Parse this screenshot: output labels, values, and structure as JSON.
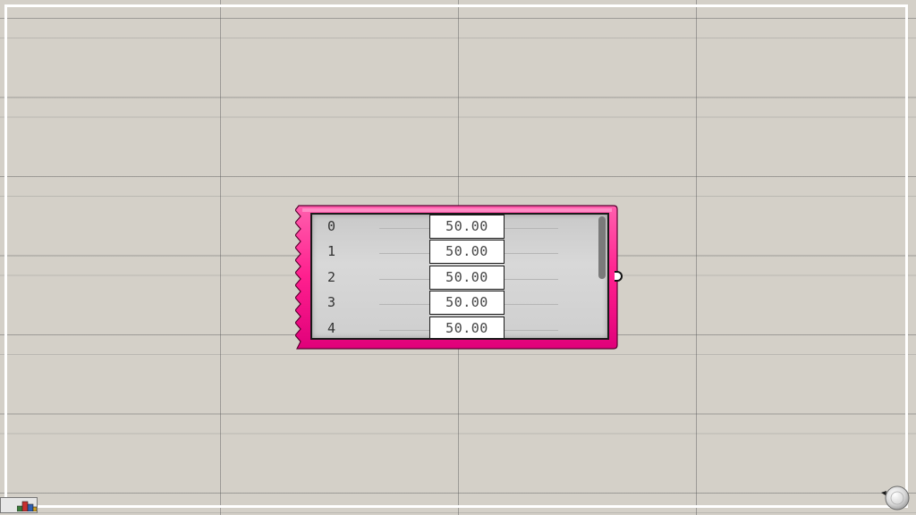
{
  "canvas": {
    "background_color": "#d4d0c8",
    "grid_color": "#5a5a5a",
    "frame_color": "#ffffff"
  },
  "component": {
    "type": "number-list-panel",
    "accent_color": "#ff1f8e",
    "accent_dark": "#c8005f",
    "rows": [
      {
        "index": "0",
        "value": "50.00"
      },
      {
        "index": "1",
        "value": "50.00"
      },
      {
        "index": "2",
        "value": "50.00"
      },
      {
        "index": "3",
        "value": "50.00"
      },
      {
        "index": "4",
        "value": "50.00"
      }
    ],
    "scroll_position": 0.0
  },
  "icons": {
    "toolbar": "component-stack-icon",
    "navigation": "navigation-compass-icon",
    "output": "output-port-icon"
  }
}
